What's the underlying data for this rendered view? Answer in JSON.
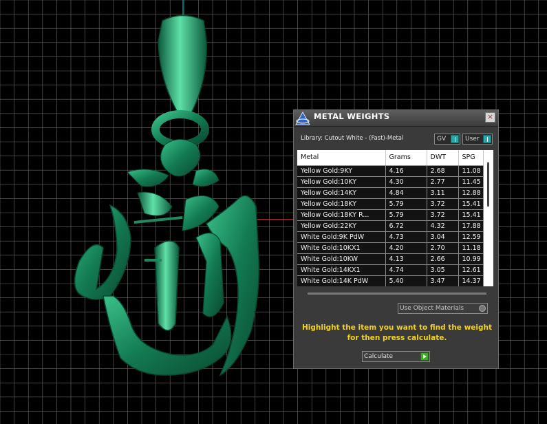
{
  "panel": {
    "title": "METAL WEIGHTS",
    "close_glyph": "×",
    "library_label": "Library: Cutout White - (Fast)-Metal",
    "gv_toggle": "GV",
    "user_toggle": "User",
    "columns": [
      "Metal",
      "Grams",
      "DWT",
      "SPG"
    ],
    "rows": [
      {
        "metal": "Yellow Gold:9KY",
        "grams": "4.16",
        "dwt": "2.68",
        "spg": "11.08"
      },
      {
        "metal": "Yellow Gold:10KY",
        "grams": "4.30",
        "dwt": "2.77",
        "spg": "11.45"
      },
      {
        "metal": "Yellow Gold:14KY",
        "grams": "4.84",
        "dwt": "3.11",
        "spg": "12.88"
      },
      {
        "metal": "Yellow Gold:18KY",
        "grams": "5.79",
        "dwt": "3.72",
        "spg": "15.41"
      },
      {
        "metal": "Yellow Gold:18KY R...",
        "grams": "5.79",
        "dwt": "3.72",
        "spg": "15.41"
      },
      {
        "metal": "Yellow Gold:22KY",
        "grams": "6.72",
        "dwt": "4.32",
        "spg": "17.88"
      },
      {
        "metal": "White Gold:9K PdW",
        "grams": "4.73",
        "dwt": "3.04",
        "spg": "12.59"
      },
      {
        "metal": "White Gold:10KX1",
        "grams": "4.20",
        "dwt": "2.70",
        "spg": "11.18"
      },
      {
        "metal": "White Gold:10KW",
        "grams": "4.13",
        "dwt": "2.66",
        "spg": "10.99"
      },
      {
        "metal": "White Gold:14KX1",
        "grams": "4.74",
        "dwt": "3.05",
        "spg": "12.61"
      },
      {
        "metal": "White Gold:14K PdW",
        "grams": "5.40",
        "dwt": "3.47",
        "spg": "14.37"
      }
    ],
    "use_object_materials": "Use Object Materials",
    "instructions": "Highlight the item you want to find the weight for then press calculate.",
    "calculate_label": "Calculate"
  },
  "icons": {
    "app_logo": "app-logo-icon",
    "close": "close-icon",
    "toggle_knob": "toggle-knob-icon",
    "go": "play-arrow-icon"
  },
  "colors": {
    "viewport_bg": "#000000",
    "grid": "#6a6a6a",
    "model": "#1f8a5e",
    "axis_y": "#1aa7a7",
    "axis_x": "#c62828",
    "instructions": "#f2d31c",
    "toggle_accent": "#28a8a8",
    "calc_accent": "#3faa2a"
  }
}
